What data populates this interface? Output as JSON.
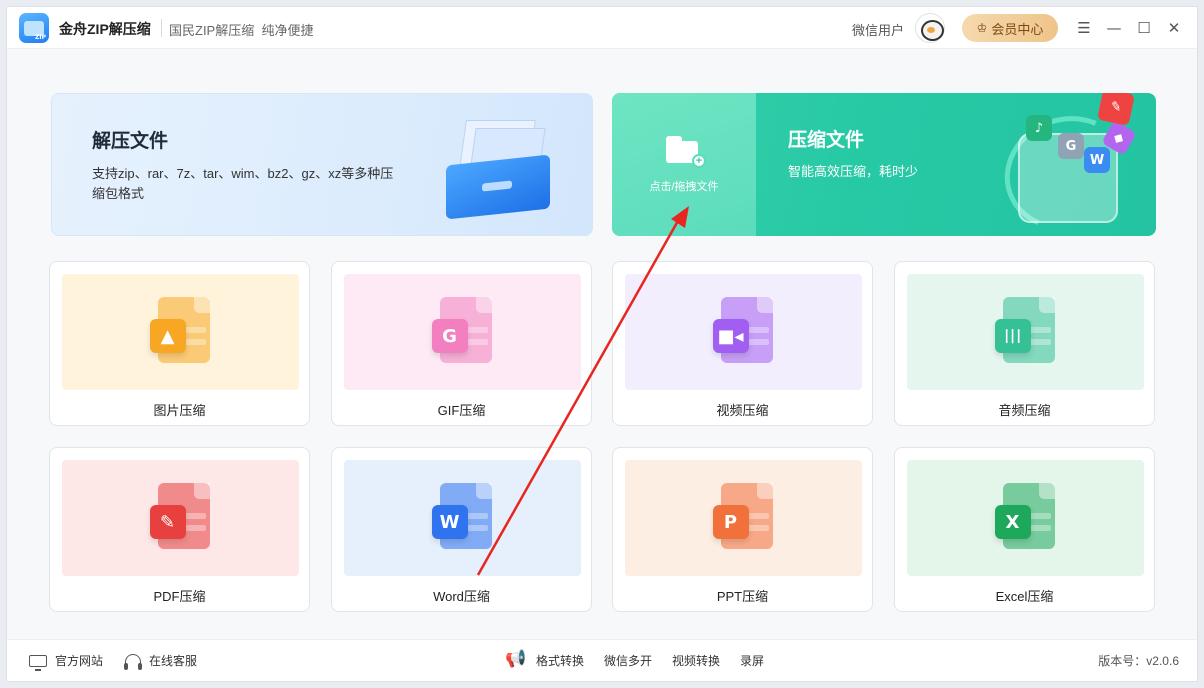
{
  "titlebar": {
    "app_name": "金舟ZIP解压缩",
    "slogan": "国民ZIP解压缩  纯净便捷",
    "user_name": "微信用户",
    "vip_label": "会员中心",
    "controls": {
      "menu": "☰",
      "minimize": "—",
      "maximize": "☐",
      "close": "✕"
    }
  },
  "decompress": {
    "title": "解压文件",
    "desc": "支持zip、rar、7z、tar、wim、bz2、gz、xz等多种压缩包格式"
  },
  "compress": {
    "drop_label": "点击/拖拽文件",
    "title": "压缩文件",
    "desc": "智能高效压缩，耗时少"
  },
  "tools": [
    {
      "label": "图片压缩",
      "icon": "image-icon",
      "badge": "",
      "color": "#f7a723",
      "tint": "#fff3dc"
    },
    {
      "label": "GIF压缩",
      "icon": "gif-icon",
      "badge": "G",
      "color": "#f27fbf",
      "tint": "#fdeaf4"
    },
    {
      "label": "视频压缩",
      "icon": "video-icon",
      "badge": "",
      "color": "#a25ef0",
      "tint": "#f3eefd"
    },
    {
      "label": "音频压缩",
      "icon": "audio-icon",
      "badge": "",
      "color": "#35c095",
      "tint": "#e5f6ef"
    },
    {
      "label": "PDF压缩",
      "icon": "pdf-icon",
      "badge": "",
      "color": "#e8403f",
      "tint": "#fde7e7"
    },
    {
      "label": "Word压缩",
      "icon": "word-icon",
      "badge": "W",
      "color": "#2f73ef",
      "tint": "#e6f0fd"
    },
    {
      "label": "PPT压缩",
      "icon": "ppt-icon",
      "badge": "P",
      "color": "#f2703a",
      "tint": "#fdeee4"
    },
    {
      "label": "Excel压缩",
      "icon": "excel-icon",
      "badge": "X",
      "color": "#1ea85c",
      "tint": "#e4f5ea"
    }
  ],
  "footer": {
    "website": "官方网站",
    "support": "在线客服",
    "links": [
      "格式转换",
      "微信多开",
      "视频转换",
      "录屏"
    ],
    "version": "版本号：v2.0.6"
  }
}
